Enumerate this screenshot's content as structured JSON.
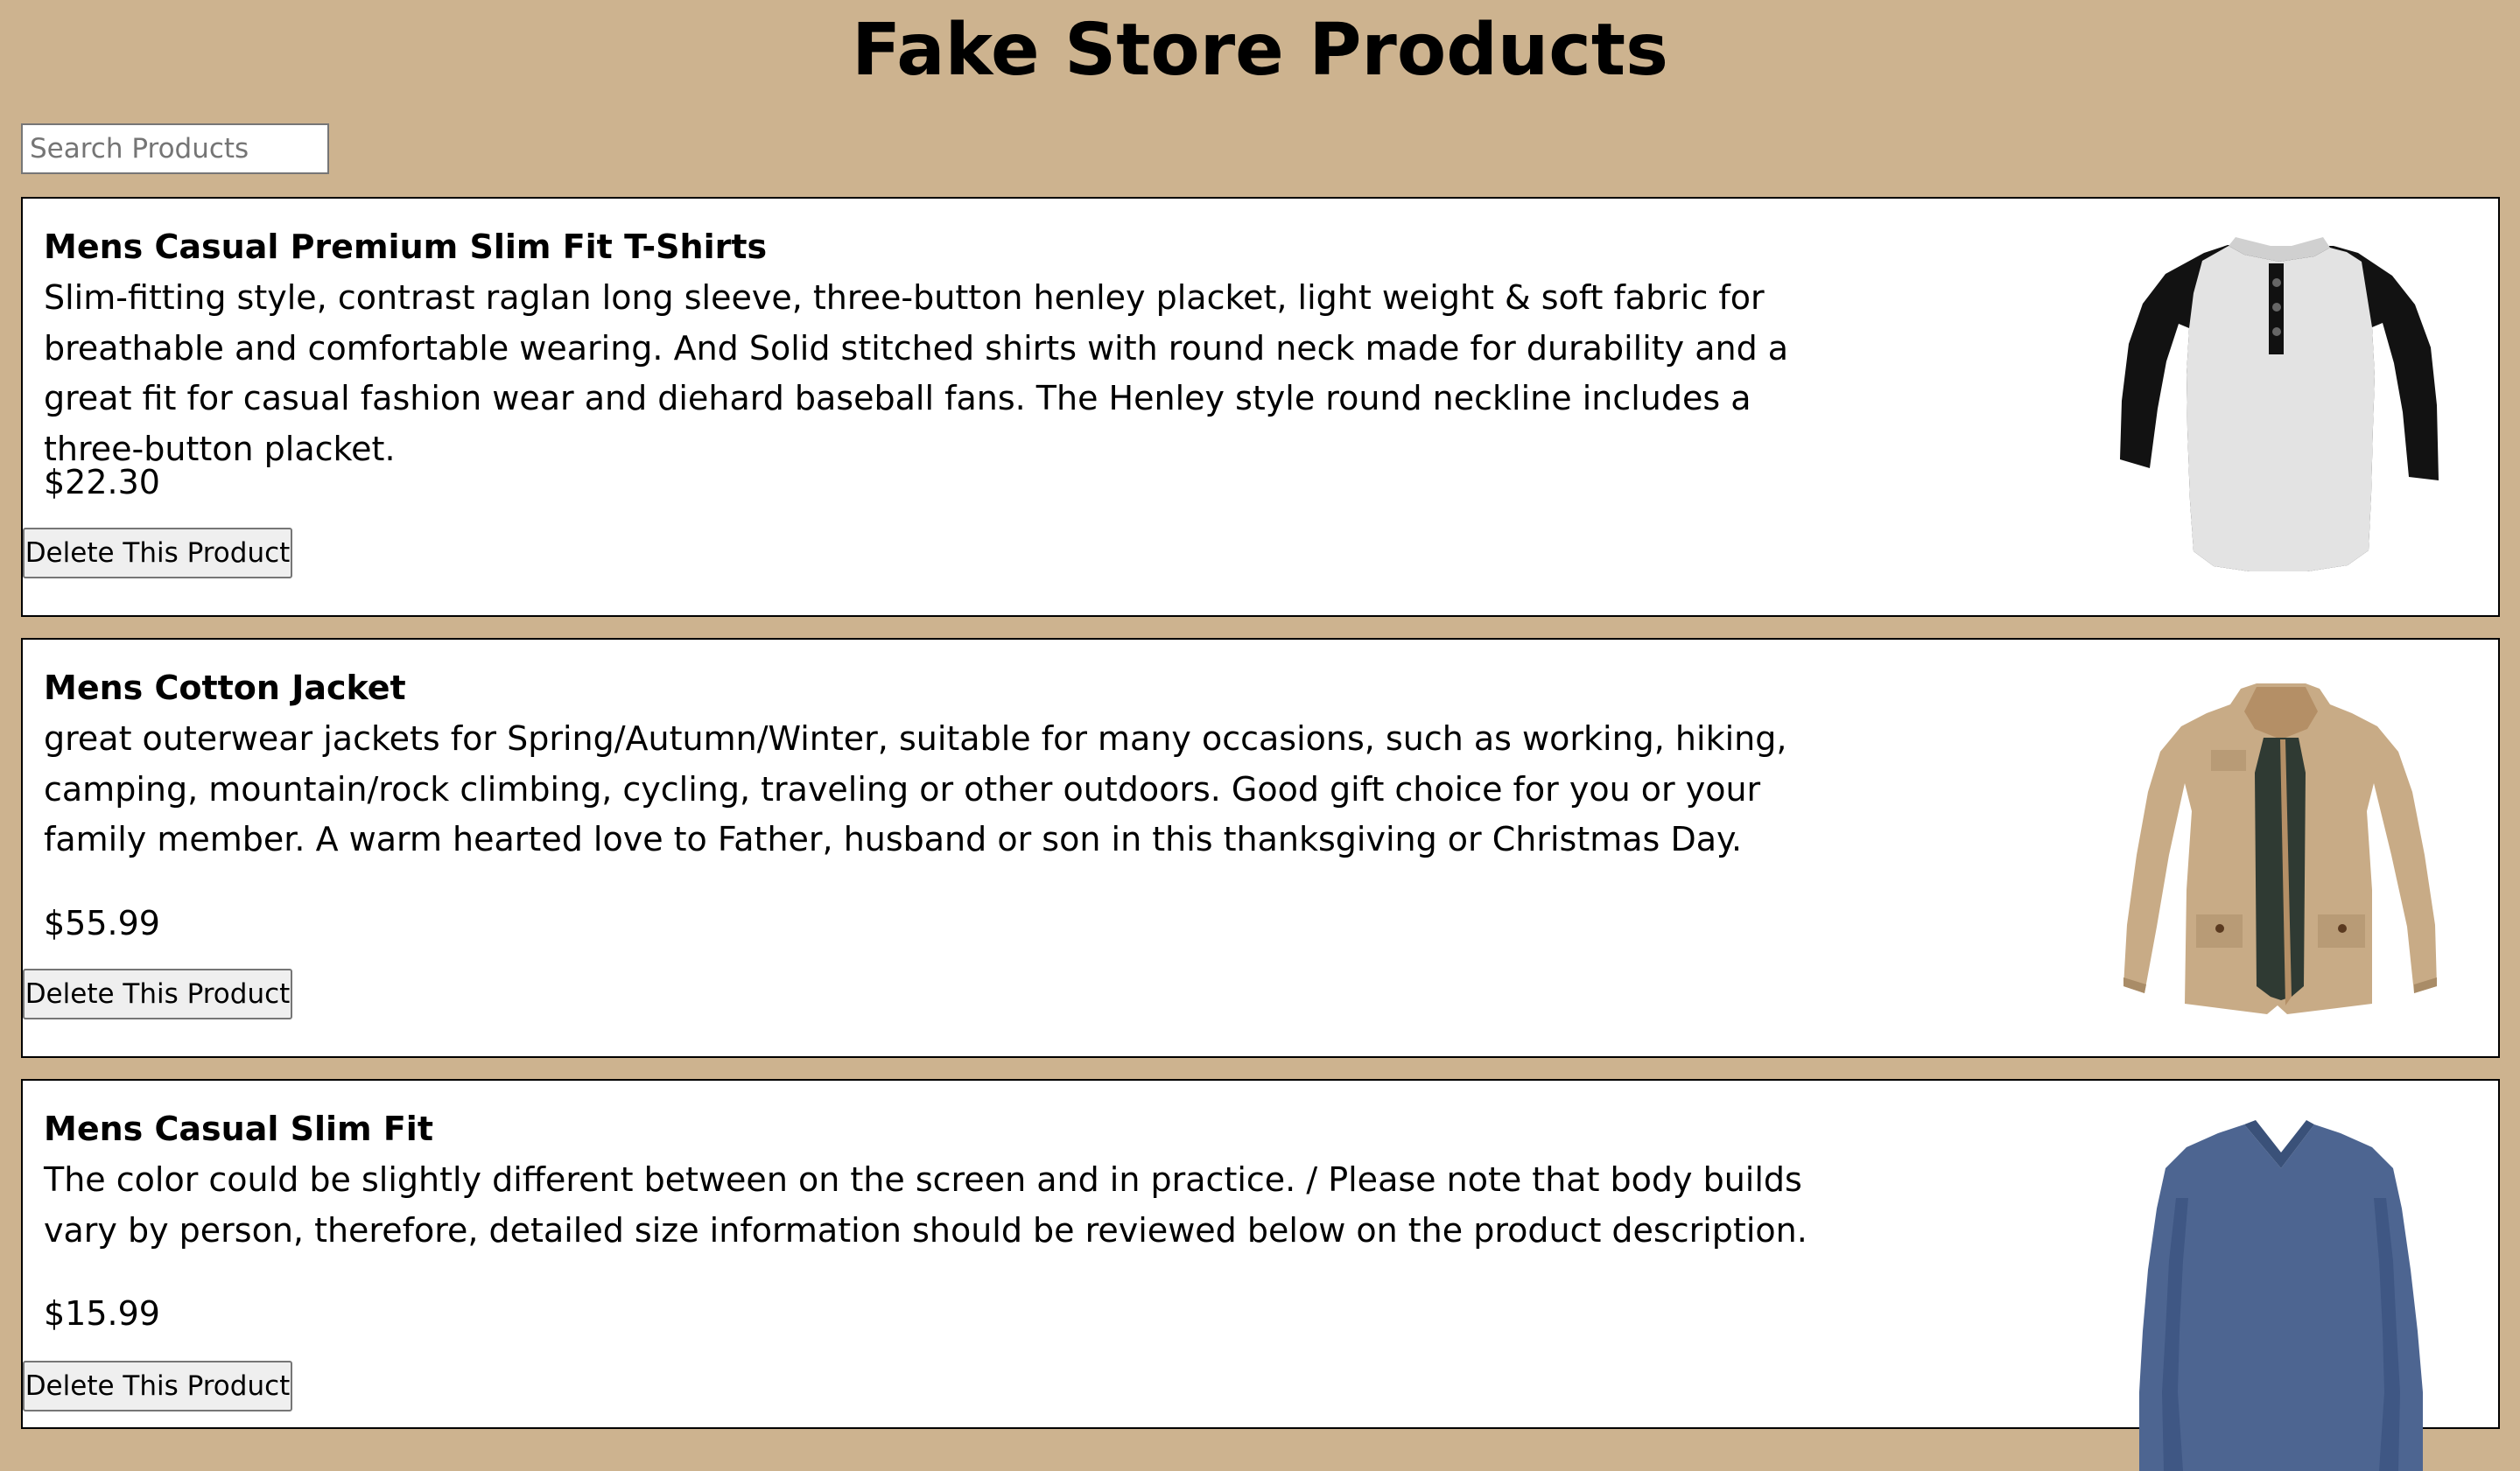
{
  "header": {
    "title": "Fake Store Products"
  },
  "search": {
    "placeholder": "Search Products",
    "value": ""
  },
  "products": [
    {
      "title": "Mens Casual Premium Slim Fit T-Shirts",
      "description": "Slim-fitting style, contrast raglan long sleeve, three-button henley placket, light weight & soft fabric for breathable and comfortable wearing. And Solid stitched shirts with round neck made for durability and a great fit for casual fashion wear and diehard baseball fans. The Henley style round neckline includes a three-button placket.",
      "price": "$22.30",
      "delete_label": "Delete This Product",
      "image": "raglan-henley-shirt-image"
    },
    {
      "title": "Mens Cotton Jacket",
      "description": "great outerwear jackets for Spring/Autumn/Winter, suitable for many occasions, such as working, hiking, camping, mountain/rock climbing, cycling, traveling or other outdoors. Good gift choice for you or your family member. A warm hearted love to Father, husband or son in this thanksgiving or Christmas Day.",
      "price": "$55.99",
      "delete_label": "Delete This Product",
      "image": "khaki-cotton-jacket-image"
    },
    {
      "title": "Mens Casual Slim Fit",
      "description": "The color could be slightly different between on the screen and in practice. / Please note that body builds vary by person, therefore, detailed size information should be reviewed below on the product description.",
      "price": "$15.99",
      "delete_label": "Delete This Product",
      "image": "blue-long-sleeve-shirt-image"
    }
  ],
  "colors": {
    "page_background": "#cdb38f",
    "card_background": "#ffffff",
    "card_border": "#000000",
    "button_background": "#efefef"
  }
}
